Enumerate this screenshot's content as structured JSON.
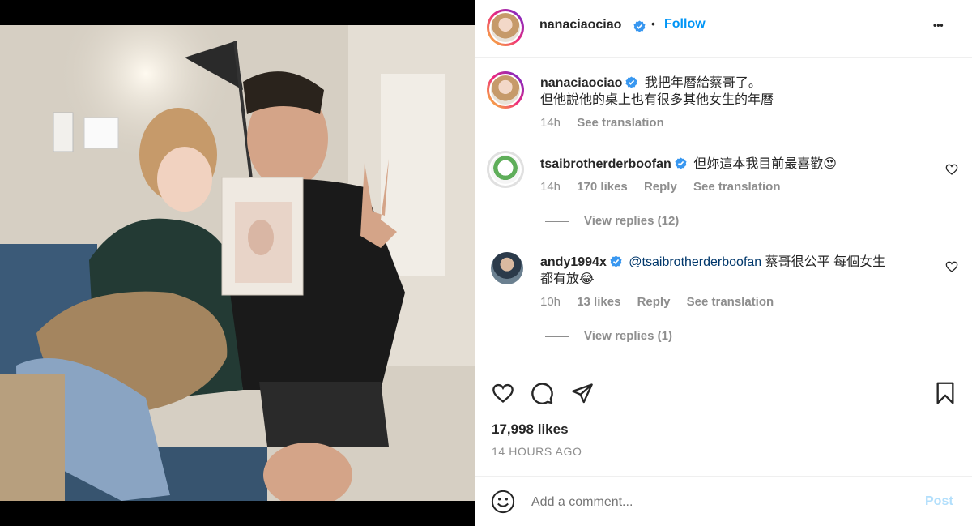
{
  "post": {
    "author": "nanaciaociao",
    "follow_label": "Follow",
    "separator": "•",
    "more_label": "•••"
  },
  "caption": {
    "author": "nanaciaociao",
    "line1": "我把年曆給蔡哥了。",
    "line2": "但他說他的桌上也有很多其他女生的年曆",
    "time": "14h",
    "see_translation": "See translation"
  },
  "comments": [
    {
      "author": "tsaibrotherderboofan",
      "text": "但妳這本我目前最喜歡😍",
      "time": "14h",
      "likes": "170 likes",
      "reply": "Reply",
      "see_translation": "See translation",
      "view_replies": "View replies (12)"
    },
    {
      "author": "andy1994x",
      "mention": "@tsaibrotherderboofan",
      "text_line1": " 蔡哥很公平 每個女生",
      "text_line2": "都有放😂",
      "time": "10h",
      "likes": "13 likes",
      "reply": "Reply",
      "see_translation": "See translation",
      "view_replies": "View replies (1)"
    }
  ],
  "actions": {
    "likes_count": "17,998 likes",
    "timestamp": "14 HOURS AGO",
    "icons": [
      "heart-icon",
      "comment-icon",
      "share-icon",
      "bookmark-icon"
    ]
  },
  "composer": {
    "placeholder": "Add a comment...",
    "post_label": "Post"
  },
  "colors": {
    "link_blue": "#0095f6",
    "verified_blue": "#3897f0",
    "muted": "#8e8e8e",
    "post_disabled": "#b2dffc"
  }
}
